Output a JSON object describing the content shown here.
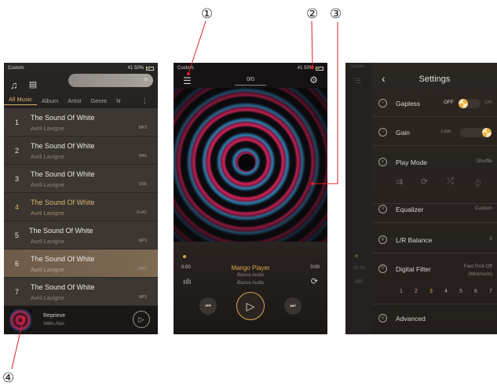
{
  "callouts": [
    "①",
    "②",
    "③",
    "④"
  ],
  "screen1": {
    "status": {
      "left": "Custom",
      "right": "41  50%"
    },
    "icons": {
      "music": "music-note-icon",
      "doc": "document-icon",
      "search": "search-icon"
    },
    "tabs": [
      "All Music",
      "Album",
      "Artist",
      "Genre",
      "N"
    ],
    "more": "⋮",
    "songs": [
      {
        "num": "1",
        "title": "The Sound Of White",
        "artist": "Avril Lavigne",
        "fmt": "MP3"
      },
      {
        "num": "2",
        "title": "The Sound Of White",
        "artist": "Avril Lavigne",
        "fmt": "M4A"
      },
      {
        "num": "3",
        "title": "The Sound Of White",
        "artist": "Avril Lavigne",
        "fmt": "DSF"
      },
      {
        "num": "4",
        "title": "The Sound Of White",
        "artist": "Avril Lavigne",
        "fmt": "FLAC"
      },
      {
        "num": "5",
        "title": "The Sound Of White",
        "artist": "Avril Lavigne",
        "fmt": "MP3"
      },
      {
        "num": "6",
        "title": "The Sound Of White",
        "artist": "Avril Lavigne",
        "fmt": "MP3"
      },
      {
        "num": "7",
        "title": "The Sound Of White",
        "artist": "Avril Lavigne",
        "fmt": "MP3"
      }
    ],
    "mini": {
      "title": "Reprieve",
      "artist": "Vallis Alps"
    }
  },
  "screen2": {
    "status": {
      "left": "Custom",
      "right": "41  50%"
    },
    "count": "0/0",
    "time_start": "0:00",
    "time_end": "0:00",
    "song": "Mango Player",
    "sub1": "iBasso Audio",
    "sub2": "iBasso Audio"
  },
  "screen3": {
    "strip": {
      "label": "Custom",
      "time": "00:00"
    },
    "title": "Settings",
    "items": {
      "gapless": {
        "label": "Gapless",
        "off": "OFF",
        "on": "ON"
      },
      "gain": {
        "label": "Gain",
        "value": "Low"
      },
      "playmode": {
        "label": "Play Mode",
        "value": "Shuffle"
      },
      "equalizer": {
        "label": "Equalizer",
        "value": "Custom"
      },
      "balance": {
        "label": "L/R Balance",
        "value": "0"
      },
      "filter": {
        "label": "Digital Filter",
        "value1": "Fast Roll-Off",
        "value2": "(Minimum)"
      },
      "advanced": {
        "label": "Advanced"
      }
    },
    "filters": [
      "1",
      "2",
      "3",
      "4",
      "5",
      "6",
      "7"
    ],
    "selected_filter": "3"
  },
  "colors": {
    "accent": "#d9a84f",
    "highlight_row": "#7e6a52"
  }
}
